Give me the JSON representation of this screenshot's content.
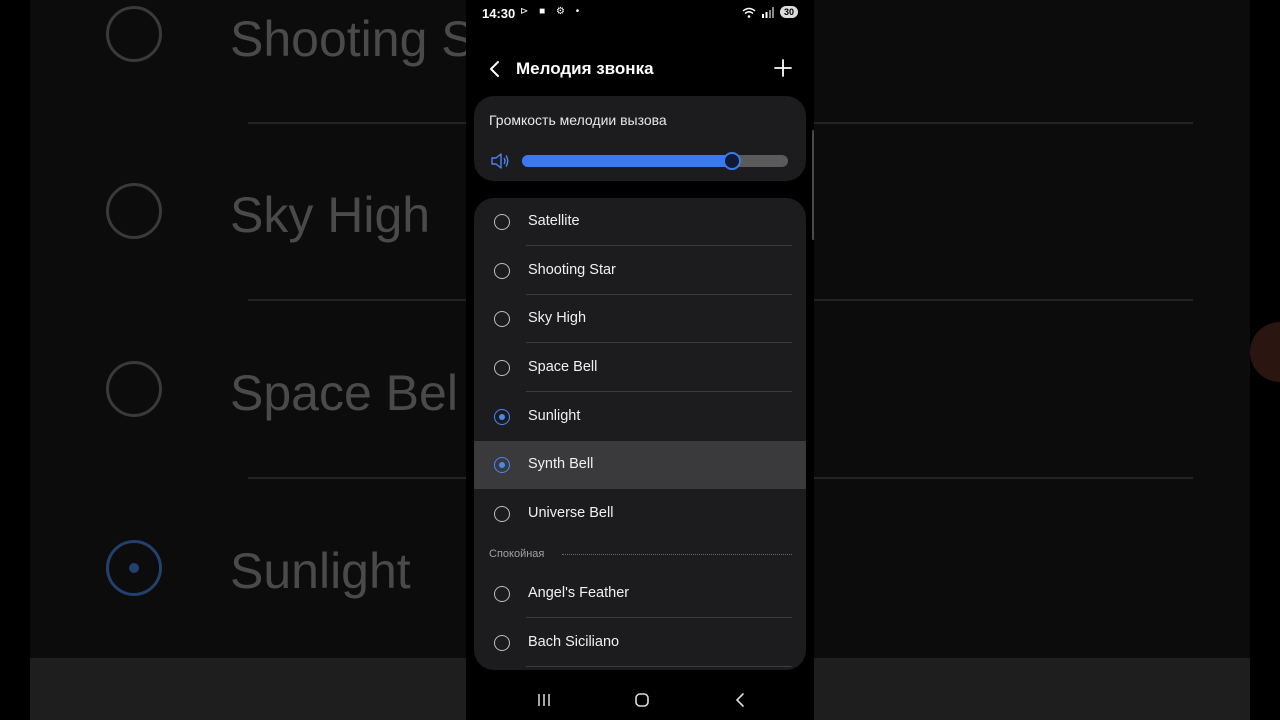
{
  "status_bar": {
    "time": "14:30",
    "battery": "30"
  },
  "header": {
    "title": "Мелодия звонка"
  },
  "volume": {
    "label": "Громкость мелодии вызова",
    "level_percent": 79
  },
  "ringtones": {
    "items": [
      {
        "label": "Satellite",
        "selected": false
      },
      {
        "label": "Shooting Star",
        "selected": false
      },
      {
        "label": "Sky High",
        "selected": false
      },
      {
        "label": "Space Bell",
        "selected": false
      },
      {
        "label": "Sunlight",
        "selected": true
      },
      {
        "label": "Synth Bell",
        "selected": true,
        "highlighted": true
      },
      {
        "label": "Universe Bell",
        "selected": false
      }
    ],
    "section_title": "Спокойная",
    "section_items": [
      {
        "label": "Angel's Feather",
        "selected": false
      },
      {
        "label": "Bach Siciliano",
        "selected": false
      }
    ]
  },
  "background": {
    "items": [
      {
        "label": "Shooting S",
        "selected": false
      },
      {
        "label": "Sky High",
        "selected": false
      },
      {
        "label": "Space Bel",
        "selected": false
      },
      {
        "label": "Sunlight",
        "selected": true
      }
    ]
  },
  "colors": {
    "accent": "#3a79f0",
    "card": "#1c1c1e",
    "highlight": "#3a3a3c"
  }
}
